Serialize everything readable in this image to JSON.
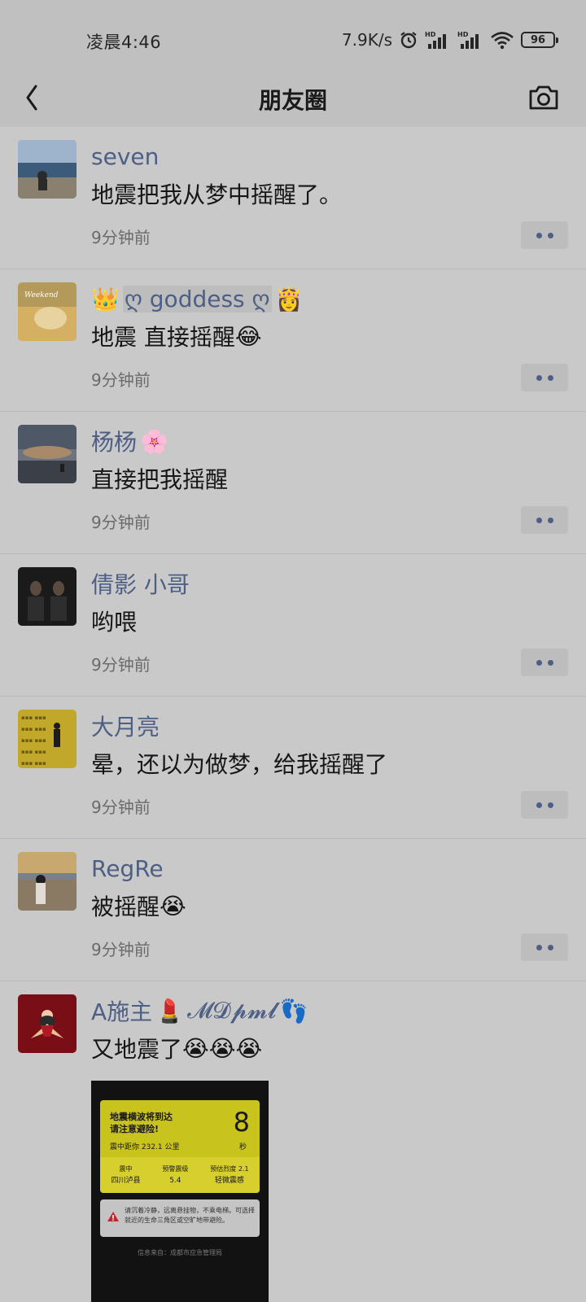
{
  "status_bar": {
    "time": "凌晨4:46",
    "net_speed": "7.9K/s",
    "battery": "96",
    "icons": [
      "alarm-icon",
      "hd-signal-icon",
      "hd-signal-icon",
      "wifi-icon",
      "battery-icon"
    ]
  },
  "header": {
    "title": "朋友圈",
    "back_icon": "chevron-left-icon",
    "camera_icon": "camera-icon"
  },
  "posts": [
    {
      "name": "seven",
      "text": "地震把我从梦中摇醒了。",
      "time": "9分钟前"
    },
    {
      "name_pre_emoji": "👑",
      "name": "ღ goddess ღ",
      "name_post_emoji": "👸",
      "text": "地震 直接摇醒",
      "text_emoji": "😂",
      "time": "9分钟前"
    },
    {
      "name": "杨杨",
      "name_post_emoji": "🌸",
      "text": "直接把我摇醒",
      "time": "9分钟前"
    },
    {
      "name": "倩影 小哥",
      "text": "哟喂",
      "time": "9分钟前"
    },
    {
      "name": "大月亮",
      "text": "晕，还以为做梦，给我摇醒了",
      "time": "9分钟前"
    },
    {
      "name": "RegRe",
      "text": "被摇醒",
      "text_emoji": "😭",
      "time": "9分钟前"
    },
    {
      "name": "A施主",
      "name_mid_emoji": "💄",
      "name_suffix": "𝓜𝓓𝓹𝓶𝓵",
      "name_post_emoji": "👣",
      "text": "又地震了",
      "text_emoji": "😭😭😭"
    }
  ],
  "alert_image": {
    "line1": "地震横波将到达",
    "line2": "请注意避险!",
    "countdown": "8",
    "unit": "秒",
    "distance": "震中距你 232.1 公里",
    "epicenter_label": "震中",
    "epicenter_value": "四川泸县",
    "magnitude_label": "预警震级",
    "magnitude_value": "5.4",
    "intensity_label": "预估烈度 2.1",
    "intensity_value": "轻微震感",
    "warning_text": "请沉着冷静，远离悬挂物，不乘电梯。可选择就近的生命三角区或空旷地带避险。",
    "source": "信息来自：成都市应急管理局"
  }
}
